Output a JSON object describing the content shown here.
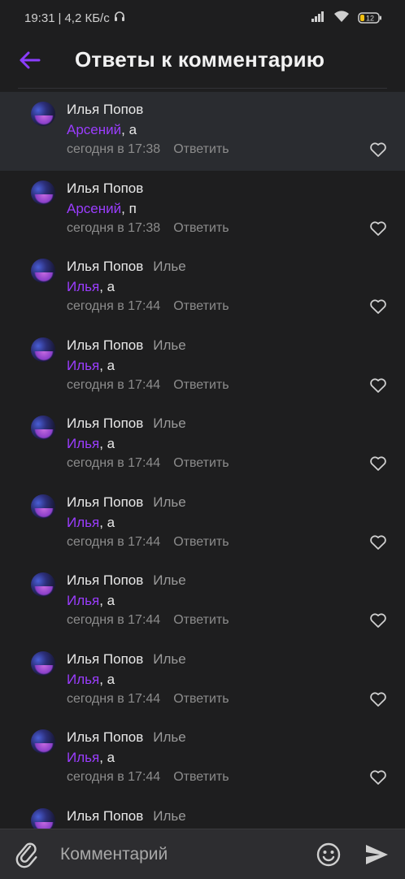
{
  "status_bar": {
    "time": "19:31",
    "separator": "|",
    "speed": "4,2 КБ/с",
    "battery": "12"
  },
  "header": {
    "back_icon": "arrow-left-icon",
    "title": "Ответы к комментарию",
    "accent_color": "#8b3dff"
  },
  "comments": [
    {
      "author": "Илья Попов",
      "reply_to": "",
      "mention": "Арсений",
      "text": ", а",
      "time": "сегодня в 17:38",
      "reply_label": "Ответить",
      "highlight": true
    },
    {
      "author": "Илья Попов",
      "reply_to": "",
      "mention": "Арсений",
      "text": ", п",
      "time": "сегодня в 17:38",
      "reply_label": "Ответить",
      "highlight": false
    },
    {
      "author": "Илья Попов",
      "reply_to": "Илье",
      "mention": "Илья",
      "text": ", а",
      "time": "сегодня в 17:44",
      "reply_label": "Ответить",
      "highlight": false
    },
    {
      "author": "Илья Попов",
      "reply_to": "Илье",
      "mention": "Илья",
      "text": ", а",
      "time": "сегодня в 17:44",
      "reply_label": "Ответить",
      "highlight": false
    },
    {
      "author": "Илья Попов",
      "reply_to": "Илье",
      "mention": "Илья",
      "text": ", а",
      "time": "сегодня в 17:44",
      "reply_label": "Ответить",
      "highlight": false
    },
    {
      "author": "Илья Попов",
      "reply_to": "Илье",
      "mention": "Илья",
      "text": ", а",
      "time": "сегодня в 17:44",
      "reply_label": "Ответить",
      "highlight": false
    },
    {
      "author": "Илья Попов",
      "reply_to": "Илье",
      "mention": "Илья",
      "text": ", а",
      "time": "сегодня в 17:44",
      "reply_label": "Ответить",
      "highlight": false
    },
    {
      "author": "Илья Попов",
      "reply_to": "Илье",
      "mention": "Илья",
      "text": ", а",
      "time": "сегодня в 17:44",
      "reply_label": "Ответить",
      "highlight": false
    },
    {
      "author": "Илья Попов",
      "reply_to": "Илье",
      "mention": "Илья",
      "text": ", а",
      "time": "сегодня в 17:44",
      "reply_label": "Ответить",
      "highlight": false
    },
    {
      "author": "Илья Попов",
      "reply_to": "Илье",
      "mention": "",
      "text": "",
      "time": "",
      "reply_label": "",
      "highlight": false
    }
  ],
  "composer": {
    "placeholder": "Комментарий",
    "attach_icon": "paperclip-icon",
    "emoji_icon": "smiley-icon",
    "send_icon": "send-icon"
  }
}
